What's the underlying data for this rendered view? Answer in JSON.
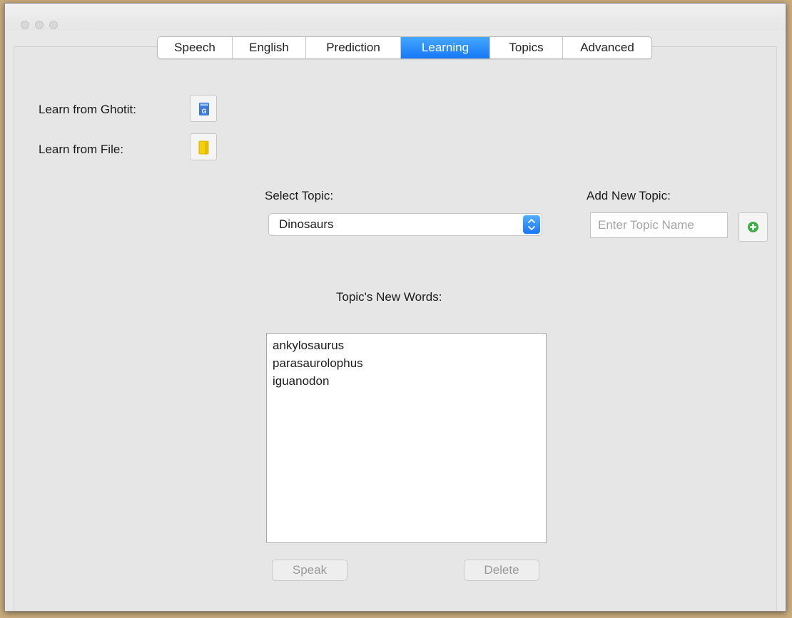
{
  "tabs": [
    {
      "label": "Speech",
      "active": false
    },
    {
      "label": "English",
      "active": false
    },
    {
      "label": "Prediction",
      "active": false
    },
    {
      "label": "Learning",
      "active": true
    },
    {
      "label": "Topics",
      "active": false
    },
    {
      "label": "Advanced",
      "active": false
    }
  ],
  "learn": {
    "ghotit_label": "Learn from Ghotit:",
    "ghotit_icon": "ghotit-book-icon",
    "file_label": "Learn from File:",
    "file_icon": "folder-icon"
  },
  "select_topic": {
    "label": "Select Topic:",
    "value": "Dinosaurs"
  },
  "add_topic": {
    "label": "Add New Topic:",
    "placeholder": "Enter Topic Name",
    "value": "",
    "button_icon": "plus-circle-icon"
  },
  "new_words": {
    "label": "Topic's New Words:",
    "items": [
      "ankylosaurus",
      "parasaurolophus",
      "iguanodon"
    ]
  },
  "buttons": {
    "speak": "Speak",
    "delete": "Delete"
  },
  "colors": {
    "accent": "#1b7ef7",
    "add_icon": "#3cae44",
    "folder_icon": "#f5d10a",
    "book_icon": "#3d7bd9"
  }
}
